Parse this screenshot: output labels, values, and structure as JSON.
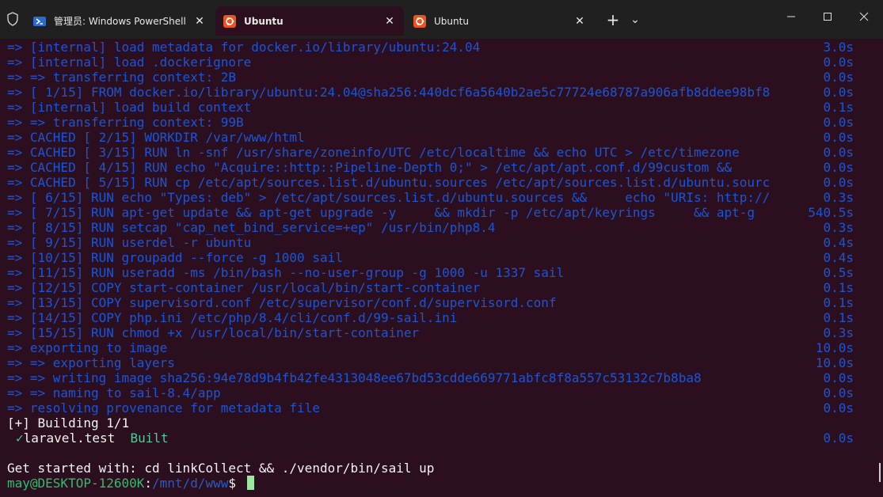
{
  "tabs": [
    {
      "label": "管理员: Windows PowerShell",
      "icon": "powershell-icon"
    },
    {
      "label": "Ubuntu",
      "icon": "ubuntu-icon"
    },
    {
      "label": "Ubuntu",
      "icon": "ubuntu-icon"
    }
  ],
  "titlebar": {
    "new_tab": "+",
    "dropdown": "⌄",
    "minimize": "—",
    "maximize": "☐",
    "close": "✕"
  },
  "colors": {
    "terminal_bg": "#2c0f1f",
    "log_blue": "#1a55d6",
    "ubuntu_orange": "#e95420"
  },
  "terminal": {
    "log_lines": [
      {
        "text": "=> [internal] load metadata for docker.io/library/ubuntu:24.04",
        "time": "3.0s"
      },
      {
        "text": "=> [internal] load .dockerignore",
        "time": "0.0s"
      },
      {
        "text": "=> => transferring context: 2B",
        "time": "0.0s"
      },
      {
        "text": "=> [ 1/15] FROM docker.io/library/ubuntu:24.04@sha256:440dcf6a5640b2ae5c77724e68787a906afb8ddee98bf8",
        "time": "0.0s"
      },
      {
        "text": "=> [internal] load build context",
        "time": "0.1s"
      },
      {
        "text": "=> => transferring context: 99B",
        "time": "0.0s"
      },
      {
        "text": "=> CACHED [ 2/15] WORKDIR /var/www/html",
        "time": "0.0s"
      },
      {
        "text": "=> CACHED [ 3/15] RUN ln -snf /usr/share/zoneinfo/UTC /etc/localtime && echo UTC > /etc/timezone",
        "time": "0.0s"
      },
      {
        "text": "=> CACHED [ 4/15] RUN echo \"Acquire::http::Pipeline-Depth 0;\" > /etc/apt/apt.conf.d/99custom &&",
        "time": "0.0s"
      },
      {
        "text": "=> CACHED [ 5/15] RUN cp /etc/apt/sources.list.d/ubuntu.sources /etc/apt/sources.list.d/ubuntu.sourc",
        "time": "0.0s"
      },
      {
        "text": "=> [ 6/15] RUN echo \"Types: deb\" > /etc/apt/sources.list.d/ubuntu.sources &&     echo \"URIs: http://",
        "time": "0.3s"
      },
      {
        "text": "=> [ 7/15] RUN apt-get update && apt-get upgrade -y     && mkdir -p /etc/apt/keyrings     && apt-g",
        "time": "540.5s"
      },
      {
        "text": "=> [ 8/15] RUN setcap \"cap_net_bind_service=+ep\" /usr/bin/php8.4",
        "time": "0.3s"
      },
      {
        "text": "=> [ 9/15] RUN userdel -r ubuntu",
        "time": "0.4s"
      },
      {
        "text": "=> [10/15] RUN groupadd --force -g 1000 sail",
        "time": "0.4s"
      },
      {
        "text": "=> [11/15] RUN useradd -ms /bin/bash --no-user-group -g 1000 -u 1337 sail",
        "time": "0.5s"
      },
      {
        "text": "=> [12/15] COPY start-container /usr/local/bin/start-container",
        "time": "0.1s"
      },
      {
        "text": "=> [13/15] COPY supervisord.conf /etc/supervisor/conf.d/supervisord.conf",
        "time": "0.1s"
      },
      {
        "text": "=> [14/15] COPY php.ini /etc/php/8.4/cli/conf.d/99-sail.ini",
        "time": "0.1s"
      },
      {
        "text": "=> [15/15] RUN chmod +x /usr/local/bin/start-container",
        "time": "0.3s"
      },
      {
        "text": "=> exporting to image",
        "time": "10.0s"
      },
      {
        "text": "=> => exporting layers",
        "time": "10.0s"
      },
      {
        "text": "=> => writing image sha256:94e78d9b4fb42fe4313048ee67bd53cdde669771abfc8f8a557c53132c7b8ba8",
        "time": "0.0s"
      },
      {
        "text": "=> => naming to sail-8.4/app",
        "time": "0.0s"
      },
      {
        "text": "=> resolving provenance for metadata file",
        "time": "0.0s"
      }
    ],
    "building": "[+] Building 1/1",
    "check": "✓",
    "built_name": "laravel.test",
    "built_status": "Built",
    "built_time": "0.0s",
    "get_started": "Get started with: cd linkCollect && ./vendor/bin/sail up",
    "prompt_user": "may@DESKTOP-12600K",
    "prompt_sep": ":",
    "prompt_path": "/mnt/d/www",
    "prompt_symbol": "$ "
  }
}
